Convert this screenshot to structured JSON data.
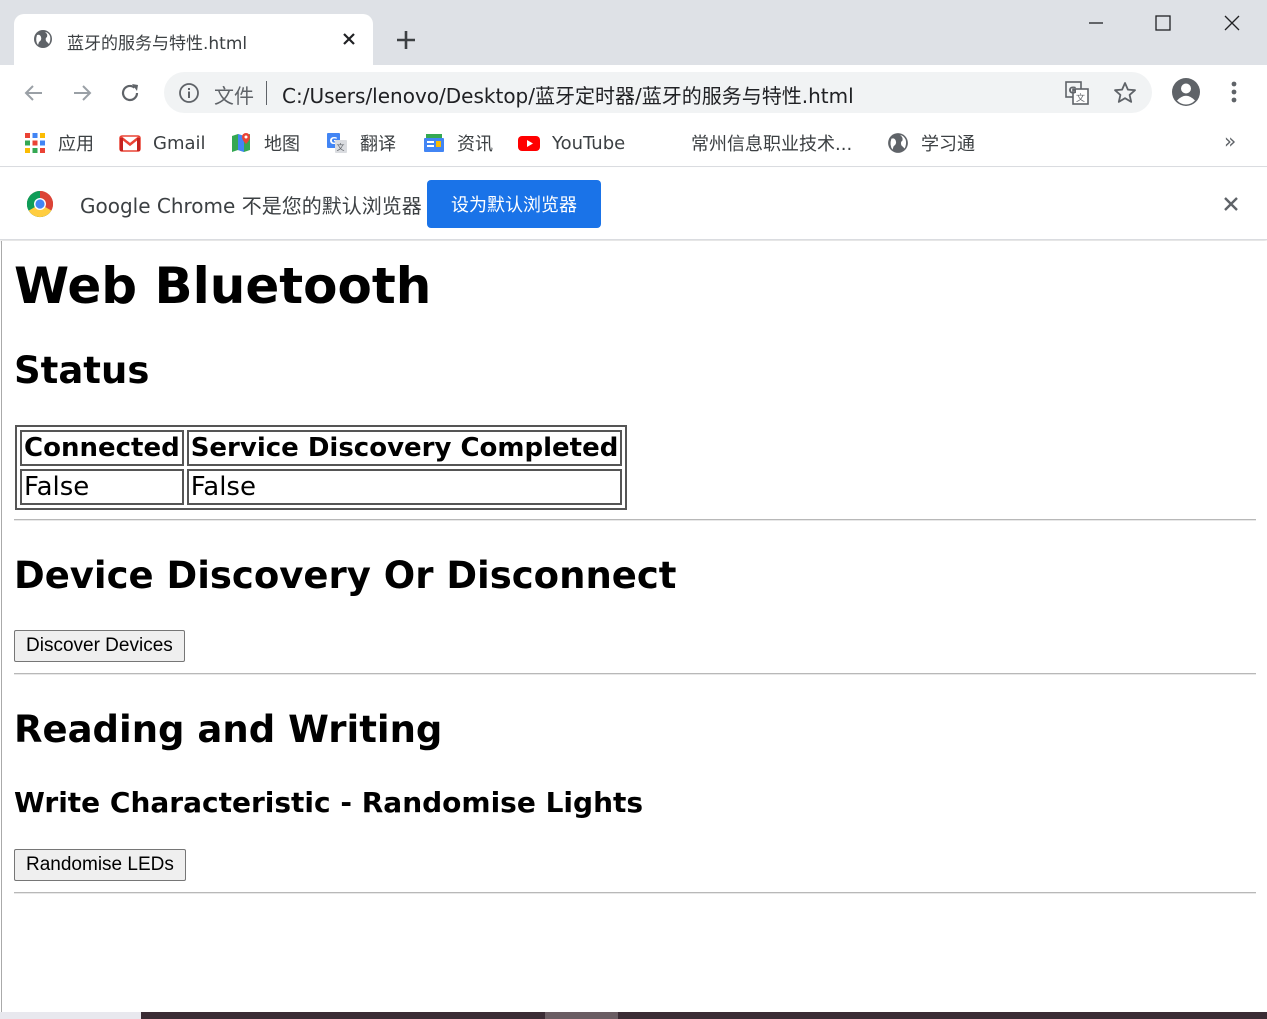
{
  "tab": {
    "title": "蓝牙的服务与特性.html",
    "favicon": "globe-icon"
  },
  "toolbar": {
    "scheme_label": "文件",
    "url": "C:/Users/lenovo/Desktop/蓝牙定时器/蓝牙的服务与特性.html"
  },
  "bookmarks": [
    {
      "label": "应用",
      "icon": "apps-grid-icon"
    },
    {
      "label": "Gmail",
      "icon": "gmail-icon"
    },
    {
      "label": "地图",
      "icon": "maps-icon"
    },
    {
      "label": "翻译",
      "icon": "translate-icon"
    },
    {
      "label": "资讯",
      "icon": "news-icon"
    },
    {
      "label": "YouTube",
      "icon": "youtube-icon"
    },
    {
      "label": "常州信息职业技术...",
      "icon": ""
    },
    {
      "label": "学习通",
      "icon": "globe-icon"
    }
  ],
  "bookmarks_more": "»",
  "infobar": {
    "message": "Google Chrome 不是您的默认浏览器",
    "button_label": "设为默认浏览器"
  },
  "page": {
    "title": "Web Bluetooth",
    "status_heading": "Status",
    "table": {
      "headers": [
        "Connected",
        "Service Discovery Completed"
      ],
      "row": [
        "False",
        "False"
      ]
    },
    "discovery_heading": "Device Discovery Or Disconnect",
    "discover_button": "Discover Devices",
    "rw_heading": "Reading and Writing",
    "write_heading": "Write Characteristic - Randomise Lights",
    "randomise_button": "Randomise LEDs"
  },
  "colors": {
    "tabstrip": "#dee1e6",
    "omnibox": "#f1f3f4",
    "accent": "#1a73e8"
  }
}
